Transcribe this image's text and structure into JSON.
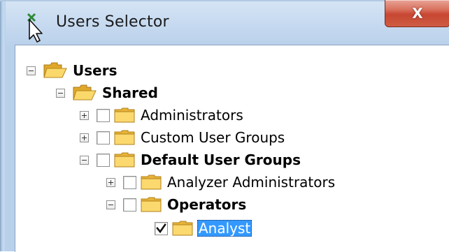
{
  "window": {
    "title": "Users Selector",
    "close_glyph": "X"
  },
  "tree": {
    "users": {
      "label": "Users",
      "expanded": true
    },
    "shared": {
      "label": "Shared",
      "expanded": true
    },
    "administrators": {
      "label": "Administrators",
      "expanded": false,
      "checked": false
    },
    "custom_user_groups": {
      "label": "Custom User Groups",
      "expanded": false,
      "checked": false
    },
    "default_user_groups": {
      "label": "Default User Groups",
      "expanded": true,
      "checked": false
    },
    "analyzer_administrators": {
      "label": "Analyzer Administrators",
      "expanded": false,
      "checked": false
    },
    "operators": {
      "label": "Operators",
      "expanded": true,
      "checked": false
    },
    "analyst": {
      "label": "Analyst",
      "checked": true,
      "selected": true
    }
  },
  "colors": {
    "selection": "#3399ff",
    "folder": "#f3c244",
    "close_button": "#c74632"
  }
}
